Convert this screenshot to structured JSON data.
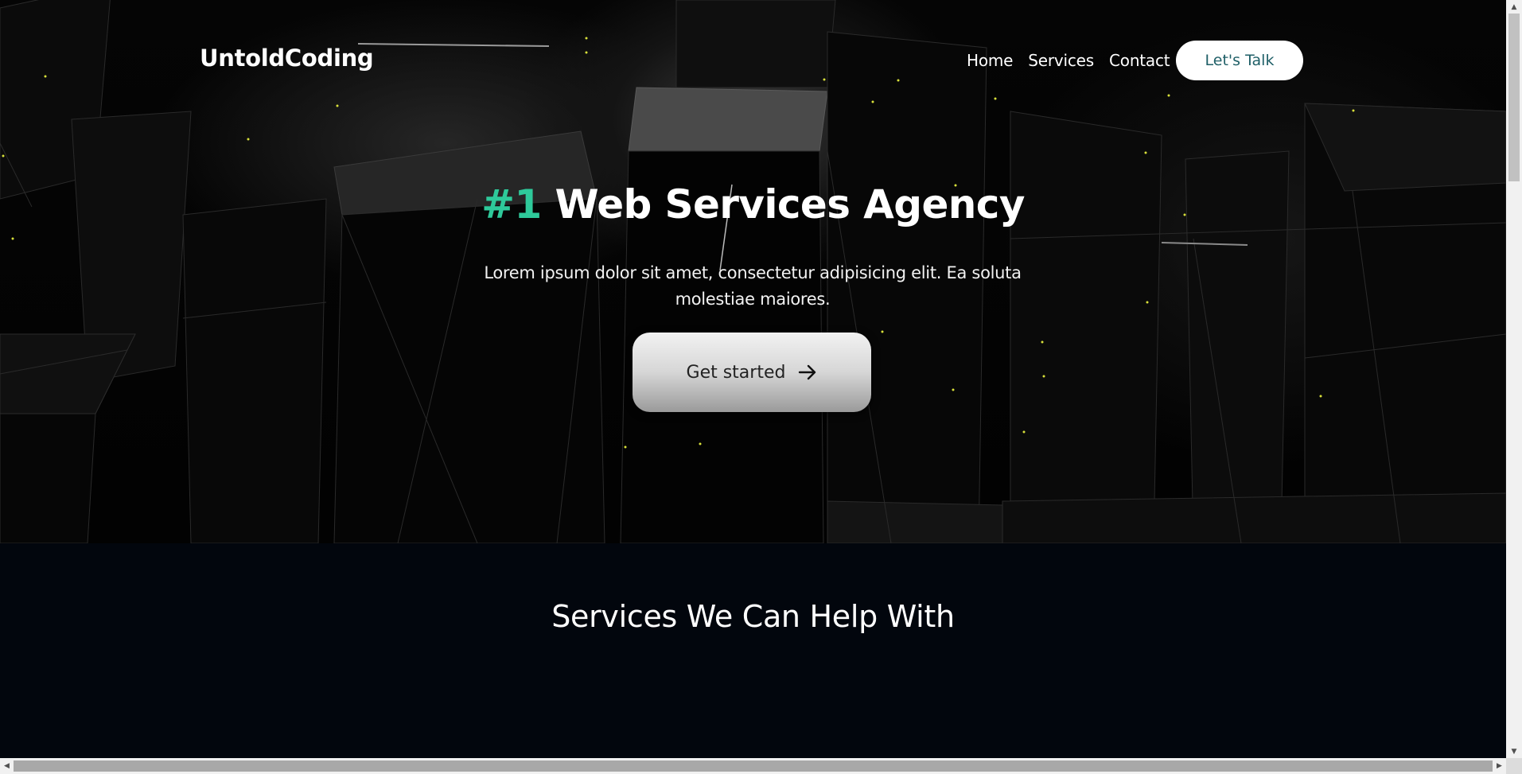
{
  "header": {
    "logo": "UntoldCoding",
    "nav": [
      {
        "label": "Home"
      },
      {
        "label": "Services"
      },
      {
        "label": "Contact"
      }
    ],
    "cta_label": "Let's Talk"
  },
  "hero": {
    "title_accent": "#1",
    "title_rest": " Web Services Agency",
    "subtitle": "Lorem ipsum dolor sit amet, consectetur adipisicing elit. Ea soluta molestiae maiores.",
    "button_label": "Get started",
    "button_icon": "arrow-right-icon"
  },
  "services": {
    "title": "Services We Can Help With"
  },
  "colors": {
    "accent": "#2ec99a",
    "talk_text": "#1f5f67",
    "services_bg": "#02060d"
  }
}
